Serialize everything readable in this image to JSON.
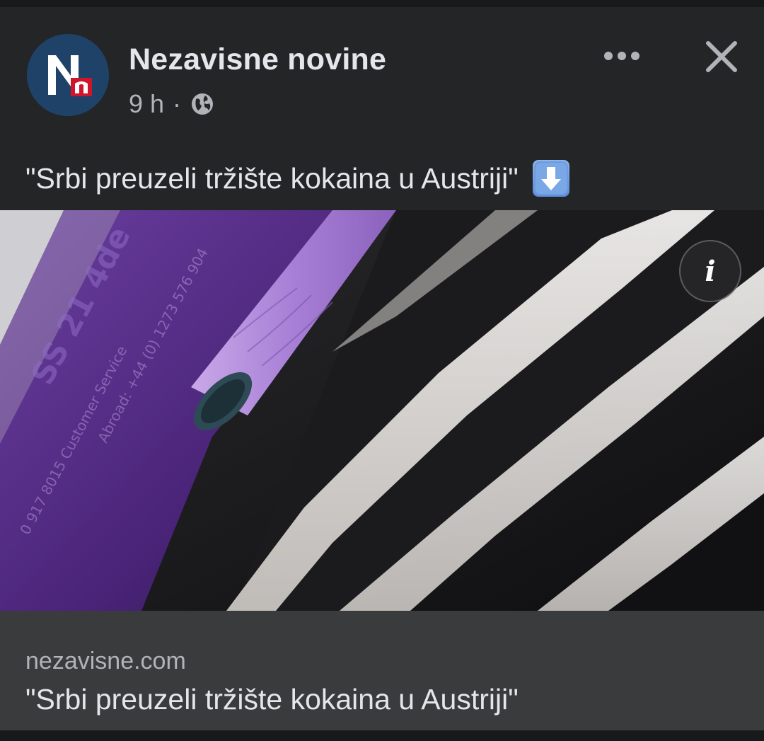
{
  "post": {
    "page_name": "Nezavisne novine",
    "time": "9 h",
    "separator": "·",
    "privacy_icon": "globe-icon",
    "text": "\"Srbi preuzeli tržište kokaina u Austriji\"",
    "text_emoji": "down-arrow-emoji",
    "avatar_letters": "Nn"
  },
  "header_actions": {
    "more_icon": "more-horizontal-icon",
    "close_icon": "close-icon"
  },
  "photo": {
    "info_label": "i"
  },
  "link_preview": {
    "domain": "nezavisne.com",
    "title": "\"Srbi preuzeli tržište kokaina u Austriji\""
  },
  "colors": {
    "background": "#18191b",
    "card": "#242526",
    "link_card": "#3a3b3c",
    "avatar_bg": "#1f3f63",
    "brand_red": "#d0152a"
  }
}
